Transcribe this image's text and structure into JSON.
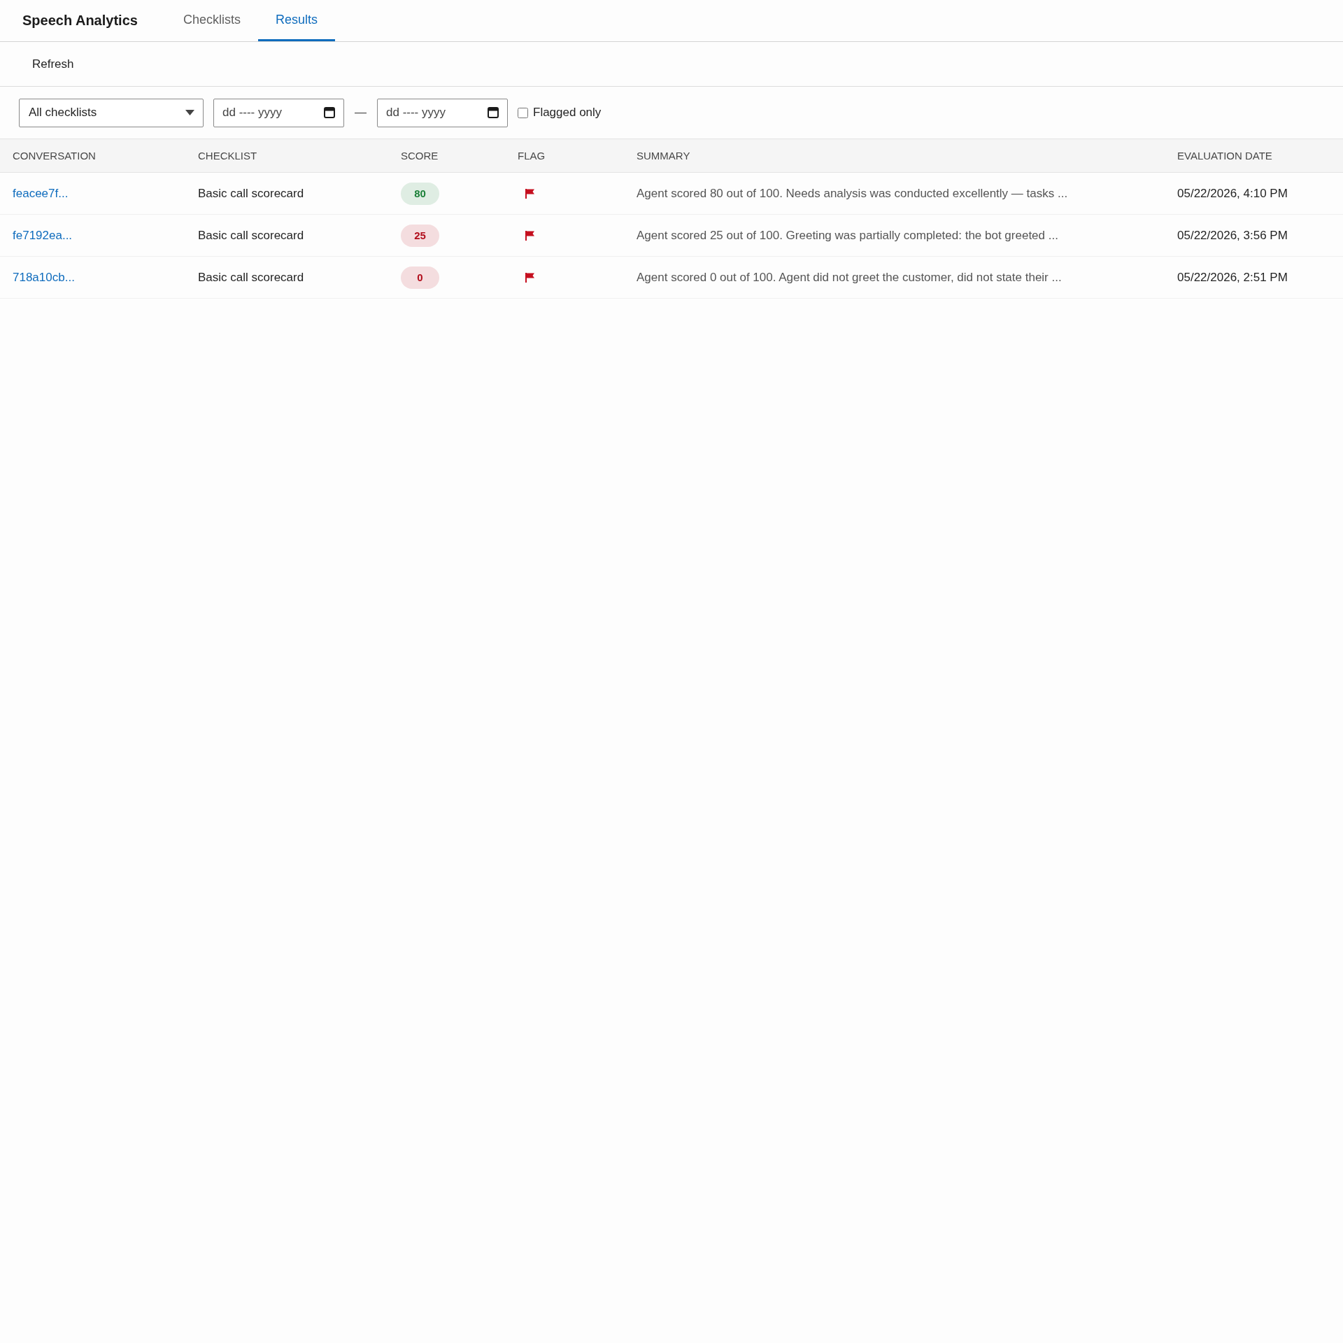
{
  "app_title": "Speech Analytics",
  "tabs": [
    {
      "label": "Checklists",
      "selected": false
    },
    {
      "label": "Results",
      "selected": true
    }
  ],
  "toolbar": {
    "buttons": [
      "Refresh"
    ]
  },
  "filters": {
    "checklist_select": {
      "value": "All checklists"
    },
    "date_from": {
      "placeholder": "dd ---- yyyy"
    },
    "range_separator": "—",
    "date_to": {
      "placeholder": "dd ---- yyyy"
    },
    "flagged_only": {
      "label": "Flagged only",
      "checked": false
    }
  },
  "table": {
    "columns": [
      "CONVERSATION",
      "CHECKLIST",
      "SCORE",
      "FLAG",
      "SUMMARY",
      "EVALUATION DATE"
    ],
    "rows": [
      {
        "conversation": "feacee7f...",
        "checklist": "Basic call scorecard",
        "score": {
          "value": "80",
          "color": "#1a7f37"
        },
        "flagged": true,
        "summary": "Agent scored 80 out of 100. Needs analysis was conducted excellently — tasks ...",
        "evaluation_date": "05/22/2026, 4:10 PM"
      },
      {
        "conversation": "fe7192ea...",
        "checklist": "Basic call scorecard",
        "score": {
          "value": "25",
          "color": "#b10e1c"
        },
        "flagged": true,
        "summary": "Agent scored 25 out of 100. Greeting was partially completed: the bot greeted ...",
        "evaluation_date": "05/22/2026, 3:56 PM"
      },
      {
        "conversation": "718a10cb...",
        "checklist": "Basic call scorecard",
        "score": {
          "value": "0",
          "color": "#b10e1c"
        },
        "flagged": true,
        "summary": "Agent scored 0 out of 100. Agent did not greet the customer, did not state their ...",
        "evaluation_date": "05/22/2026, 2:51 PM"
      }
    ]
  }
}
